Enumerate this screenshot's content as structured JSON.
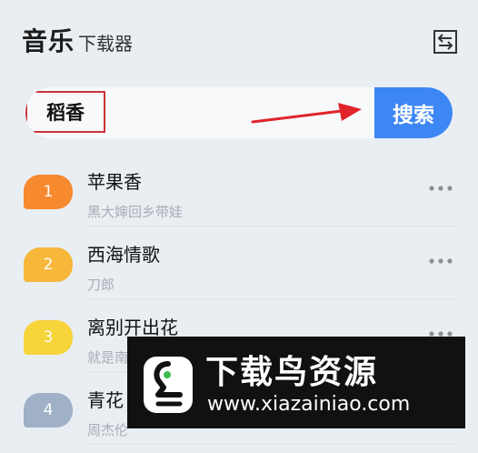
{
  "header": {
    "title": "音乐",
    "subtitle": "下载器"
  },
  "search": {
    "query": "稻香",
    "button_label": "搜索"
  },
  "songs": [
    {
      "index": "1",
      "title": "苹果香",
      "artist": "黑大婶回乡带娃",
      "color": "#f7892f"
    },
    {
      "index": "2",
      "title": "西海情歌",
      "artist": "刀郎",
      "color": "#f7b73a"
    },
    {
      "index": "3",
      "title": "离别开出花",
      "artist": "就是南",
      "color": "#f7d43a"
    },
    {
      "index": "4",
      "title": "青花",
      "artist": "周杰伦",
      "color": "#9fb0c7"
    }
  ],
  "watermark": {
    "name": "下载鸟资源",
    "url": "www.xiazainiao.com"
  },
  "colors": {
    "accent": "#3d86f5",
    "highlight_box": "#c9343a",
    "arrow": "#e0242b"
  }
}
